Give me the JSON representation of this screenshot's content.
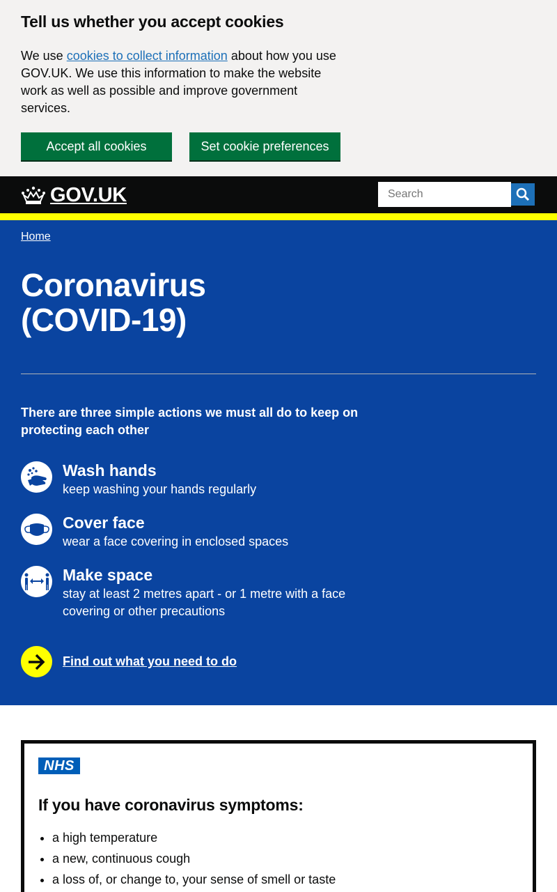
{
  "cookie_banner": {
    "title": "Tell us whether you accept cookies",
    "text_before": "We use ",
    "link": "cookies to collect information",
    "text_after": " about how you use GOV.UK. We use this information to make the website work as well as possible and improve government services.",
    "accept_label": "Accept all cookies",
    "preferences_label": "Set cookie preferences"
  },
  "header": {
    "logo_text": "GOV.UK",
    "search_placeholder": "Search"
  },
  "hero": {
    "breadcrumb": "Home",
    "title": "Coronavirus (COVID-19)",
    "lead": "There are three simple actions we must all do to keep on protecting each other",
    "actions": [
      {
        "title": "Wash hands",
        "desc": "keep washing your hands regularly",
        "icon": "wash-hands-icon"
      },
      {
        "title": "Cover face",
        "desc": "wear a face covering in enclosed spaces",
        "icon": "face-mask-icon"
      },
      {
        "title": "Make space",
        "desc": "stay at least 2 metres apart - or 1 metre with a face covering or other precautions",
        "icon": "distance-icon"
      }
    ],
    "cta": "Find out what you need to do"
  },
  "nhs": {
    "logo": "NHS",
    "heading": "If you have coronavirus symptoms:",
    "symptoms": [
      "a high temperature",
      "a new, continuous cough",
      "a loss of, or change to, your sense of smell or taste"
    ]
  },
  "colors": {
    "hero_blue": "#0a44a0",
    "button_green": "#00703c",
    "header_black": "#0b0c0c",
    "stripe_yellow": "#ffff00",
    "nhs_blue": "#005eb8"
  }
}
